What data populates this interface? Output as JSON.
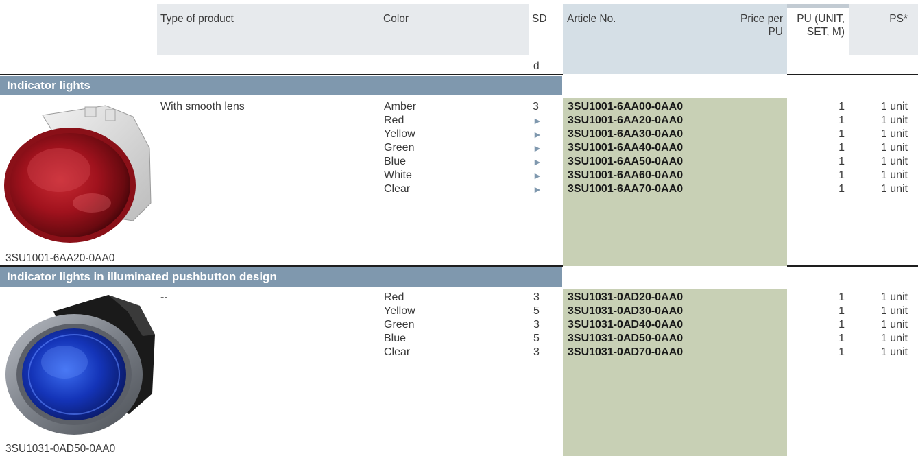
{
  "header": {
    "type_of_product": "Type of product",
    "color": "Color",
    "sd": "SD",
    "sd_unit": "d",
    "article_no": "Article No.",
    "price": "Price per PU",
    "pu": "PU (UNIT, SET, M)",
    "ps": "PS*"
  },
  "sections": [
    {
      "title": "Indicator lights",
      "type": "With smooth lens",
      "image_caption": "3SU1001-6AA20-0AA0",
      "colors": [
        "Amber",
        "Red",
        "Yellow",
        "Green",
        "Blue",
        "White",
        "Clear"
      ],
      "sd": [
        "3",
        "►",
        "►",
        "►",
        "►",
        "►",
        "►"
      ],
      "articles": [
        "3SU1001-6AA00-0AA0",
        "3SU1001-6AA20-0AA0",
        "3SU1001-6AA30-0AA0",
        "3SU1001-6AA40-0AA0",
        "3SU1001-6AA50-0AA0",
        "3SU1001-6AA60-0AA0",
        "3SU1001-6AA70-0AA0"
      ],
      "pu": [
        "1",
        "1",
        "1",
        "1",
        "1",
        "1",
        "1"
      ],
      "ps": [
        "1 unit",
        "1 unit",
        "1 unit",
        "1 unit",
        "1 unit",
        "1 unit",
        "1 unit"
      ]
    },
    {
      "title": "Indicator lights in illuminated pushbutton design",
      "type": "--",
      "image_caption": "3SU1031-0AD50-0AA0",
      "colors": [
        "Red",
        "Yellow",
        "Green",
        "Blue",
        "Clear"
      ],
      "sd": [
        "3",
        "5",
        "3",
        "5",
        "3"
      ],
      "articles": [
        "3SU1031-0AD20-0AA0",
        "3SU1031-0AD30-0AA0",
        "3SU1031-0AD40-0AA0",
        "3SU1031-0AD50-0AA0",
        "3SU1031-0AD70-0AA0"
      ],
      "pu": [
        "1",
        "1",
        "1",
        "1",
        "1"
      ],
      "ps": [
        "1 unit",
        "1 unit",
        "1 unit",
        "1 unit",
        "1 unit"
      ]
    }
  ],
  "colors": {
    "section_bar": "#7f98ae",
    "article_header": "#d5dfe6",
    "article_column": "#c8d0b5",
    "header_shade": "#e7eaed",
    "arrow": "#7f98ae"
  },
  "icons": {
    "product_image_1": "red-indicator-light-icon",
    "product_image_2": "blue-pushbutton-indicator-icon",
    "availability_arrow": "triangle-right-icon"
  }
}
